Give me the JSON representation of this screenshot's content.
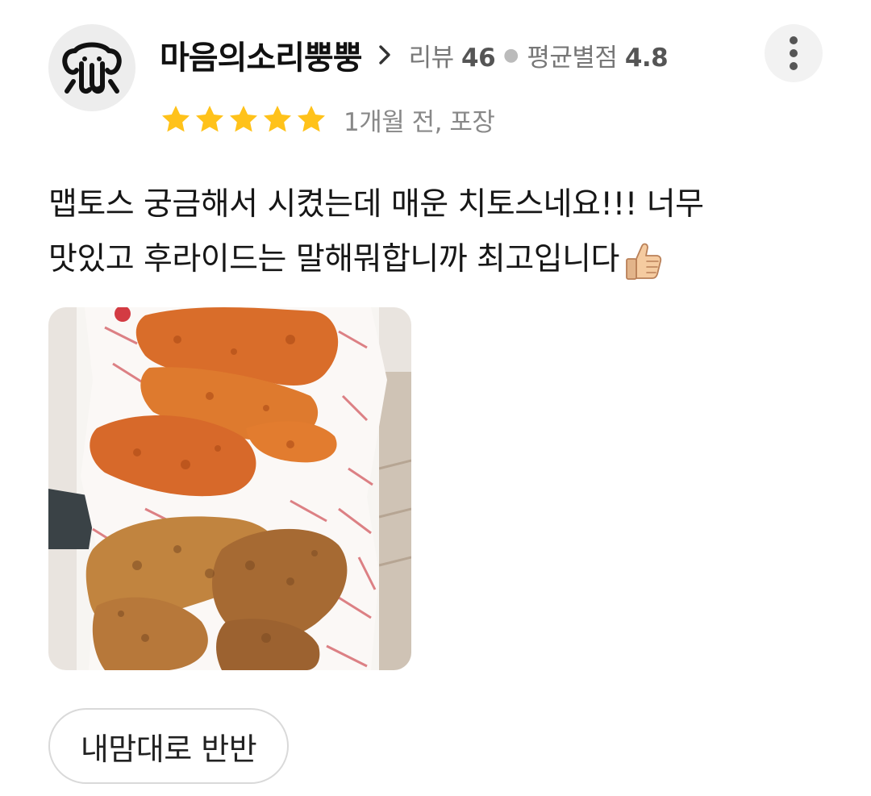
{
  "reviewer": {
    "nickname": "마음의소리뿡뿡",
    "avatar_icon": "elephant-icon",
    "review_count_label": "리뷰",
    "review_count": "46",
    "avg_rating_label": "평균별점",
    "avg_rating": "4.8"
  },
  "review": {
    "star_rating": 5,
    "star_color": "#FFC21A",
    "meta": "1개월 전, 포장",
    "text_line1": "맵토스 궁금해서 시켰는데 매운 치토스네요!!! 너무",
    "text_line2": "맛있고 후라이드는 말해뭐합니까 최고입니다",
    "emoji": "thumbs-up-icon",
    "photo": "fried-chicken-photo",
    "menu_chip": "내맘대로 반반"
  },
  "actions": {
    "more_icon": "more-vertical-icon"
  }
}
